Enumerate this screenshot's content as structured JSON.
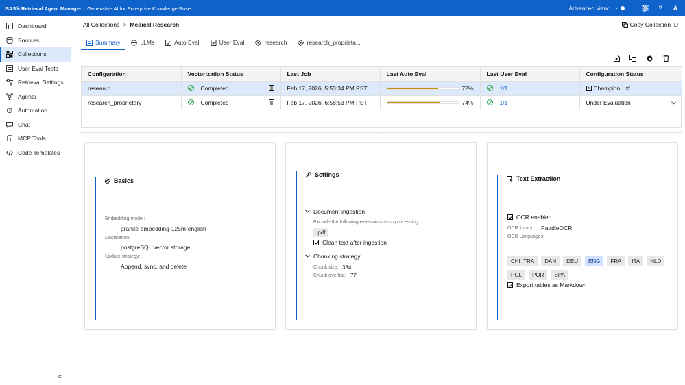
{
  "topbar": {
    "app_name": "SAS® Retrieval Agent Manager",
    "separator": "·",
    "subtitle": "Generative AI for Enterprise Knowledge Base",
    "advanced_view_label": "Advanced view:",
    "help_label": "?",
    "avatar_initial": "A",
    "accent_color": "#0f62c9"
  },
  "sidebar": {
    "items": [
      {
        "label": "Dashboard",
        "icon": "dashboard-icon"
      },
      {
        "label": "Sources",
        "icon": "database-icon"
      },
      {
        "label": "Collections",
        "icon": "collections-icon",
        "active": true
      },
      {
        "label": "User Eval Tests",
        "icon": "list-icon"
      },
      {
        "label": "Retrieval Settings",
        "icon": "sliders-icon"
      },
      {
        "label": "Agents",
        "icon": "agents-icon"
      },
      {
        "label": "Automation",
        "icon": "automation-icon"
      },
      {
        "label": "Chat",
        "icon": "chat-icon"
      },
      {
        "label": "MCP Tools",
        "icon": "tools-icon"
      },
      {
        "label": "Code Templates",
        "icon": "code-icon"
      }
    ],
    "collapse_label": "«"
  },
  "breadcrumb": {
    "parent": "All Collections",
    "separator": ">",
    "current": "Medical Research"
  },
  "copy_id_label": "Copy Collection ID",
  "tabs": [
    {
      "label": "Summary",
      "icon": "summary-icon",
      "active": true
    },
    {
      "label": "LLMs",
      "icon": "llm-icon"
    },
    {
      "label": "Auto Eval",
      "icon": "auto-eval-icon"
    },
    {
      "label": "User Eval",
      "icon": "user-eval-icon"
    },
    {
      "label": "research",
      "icon": "config-icon"
    },
    {
      "label": "research_proprieta...",
      "icon": "config-icon"
    }
  ],
  "table": {
    "headers": [
      "Configuration",
      "Vectorization Status",
      "Last Job",
      "Last Auto Eval",
      "Last User Eval",
      "Configuration Status"
    ],
    "rows": [
      {
        "configuration": "research",
        "vectorization": "Completed",
        "last_job": "Feb 17, 2026, 5:53:34 PM PST",
        "auto_eval_pct": 72,
        "auto_eval_label": "72%",
        "user_eval": "1/1",
        "status": "Champion",
        "status_mark": "★",
        "selected": true
      },
      {
        "configuration": "research_proprietary",
        "vectorization": "Completed",
        "last_job": "Feb 17, 2026, 6:58:53 PM PST",
        "auto_eval_pct": 74,
        "auto_eval_label": "74%",
        "user_eval": "1/1",
        "status": "Under Evaluation",
        "selected": false
      }
    ],
    "progress_color": "#c2910d",
    "divider_handle": "...."
  },
  "cards": {
    "basics": {
      "title": "Basics",
      "icon": "gear-icon",
      "fields": [
        {
          "label": "Embedding model:",
          "value": "granite-embedding-125m-english"
        },
        {
          "label": "Destination:",
          "value": "postgreSQL vector storage"
        },
        {
          "label": "Update strategy:",
          "value": "Append, sync, and delete"
        }
      ]
    },
    "settings": {
      "title": "Settings",
      "icon": "wrench-icon",
      "doc_section": "Document ingestion",
      "exclude_label": "Exclude the following extensions from processing:",
      "exclude_value": ".pdf",
      "clean_text_label": "Clean text after ingestion",
      "chunk_section": "Chunking strategy",
      "chunk_size_label": "Chunk size:",
      "chunk_size_value": "384",
      "chunk_overlap_label": "Chunk overlap:",
      "chunk_overlap_value": "77"
    },
    "text_extraction": {
      "title": "Text Extraction",
      "icon": "text-extract-icon",
      "ocr_enabled_label": "OCR enabled",
      "ocr_library_label": "OCR library:",
      "ocr_library_value": "PaddleOCR",
      "ocr_languages_label": "OCR Languages:",
      "languages": [
        {
          "code": "CHI_TRA",
          "on": false
        },
        {
          "code": "DAN",
          "on": false
        },
        {
          "code": "DEU",
          "on": false
        },
        {
          "code": "ENG",
          "on": true
        },
        {
          "code": "FRA",
          "on": false
        },
        {
          "code": "ITA",
          "on": false
        },
        {
          "code": "NLD",
          "on": false
        },
        {
          "code": "POL",
          "on": false
        },
        {
          "code": "POR",
          "on": false
        },
        {
          "code": "SPA",
          "on": false
        }
      ],
      "export_tables_label": "Export tables as Markdown"
    }
  }
}
